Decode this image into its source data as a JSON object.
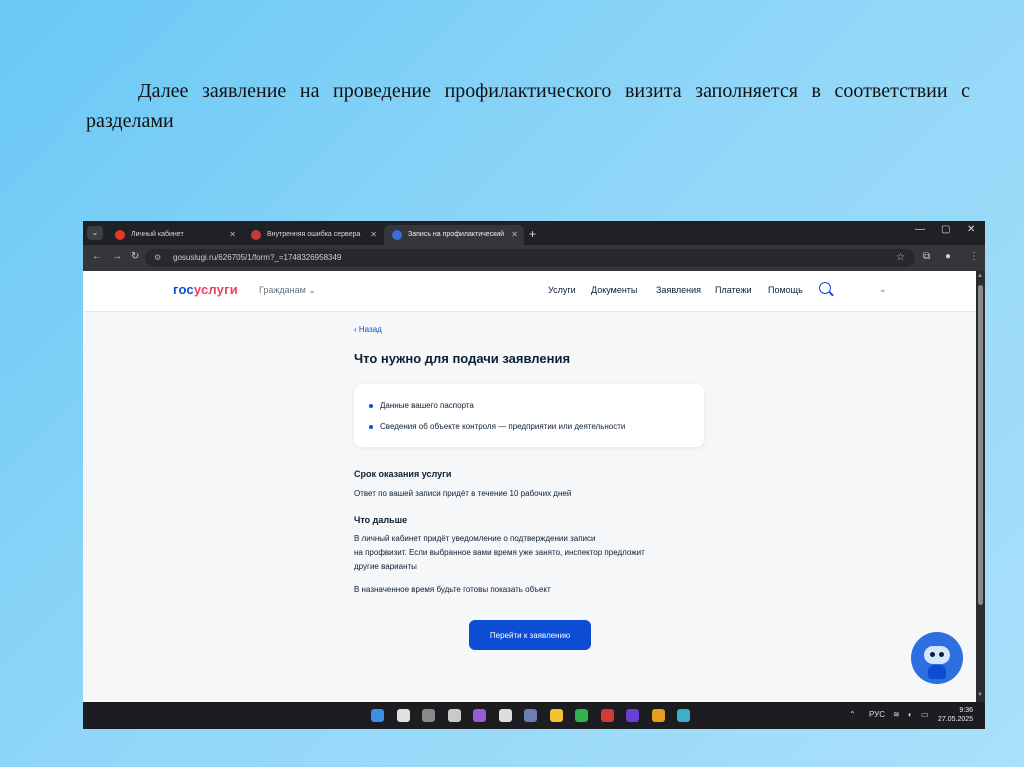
{
  "slide": {
    "caption": "Далее заявление на проведение профилактического визита заполняется в соответствии с разделами"
  },
  "browser": {
    "tabs": [
      {
        "label": "Личный кабинет",
        "favicon_color": "#e8372a",
        "active": false
      },
      {
        "label": "Внутренняя ошибка сервера",
        "favicon_color": "#c53b3b",
        "active": false
      },
      {
        "label": "Запись на профилактический",
        "favicon_color": "#3b6fd6",
        "active": true
      }
    ],
    "url": "gosuslugi.ru/626705/1/form?_=1748326958349"
  },
  "site": {
    "logo_part1": "гос",
    "logo_part2": "услуги",
    "citizens": "Гражданам",
    "menu": [
      "Услуги",
      "Документы",
      "Заявления",
      "Платежи",
      "Помощь"
    ]
  },
  "content": {
    "back": "Назад",
    "title": "Что нужно для подачи заявления",
    "requirements": [
      "Данные вашего паспорта",
      "Сведения об объекте контроля — предприятии или деятельности"
    ],
    "term_title": "Срок оказания услуги",
    "term_text": "Ответ по вашей записи придёт в течение 10 рабочих дней",
    "next_title": "Что дальше",
    "next_lines": [
      "В личный кабинет придёт уведомление о подтверждении записи",
      "на профвизит. Если выбранное вами время уже занято, инспектор предложит",
      "другие варианты"
    ],
    "next_note": "В назначенное время будьте готовы показать объект",
    "cta": "Перейти к заявлению"
  },
  "taskbar": {
    "tray_lang": "РУС",
    "time": "9:36",
    "date": "27.05.2025",
    "app_colors": [
      "#3a8ee6",
      "#e0e0e0",
      "#8a8a8a",
      "#c9c9c9",
      "#9b5ad6",
      "#dddddd",
      "#6b7fb0",
      "#f2c230",
      "#2fb34b",
      "#d23a3a",
      "#6a3fd6",
      "#e6a020",
      "#3bb0c9"
    ]
  },
  "colors": {
    "brand_blue": "#0d4cd3",
    "brand_red": "#ee3f58"
  }
}
